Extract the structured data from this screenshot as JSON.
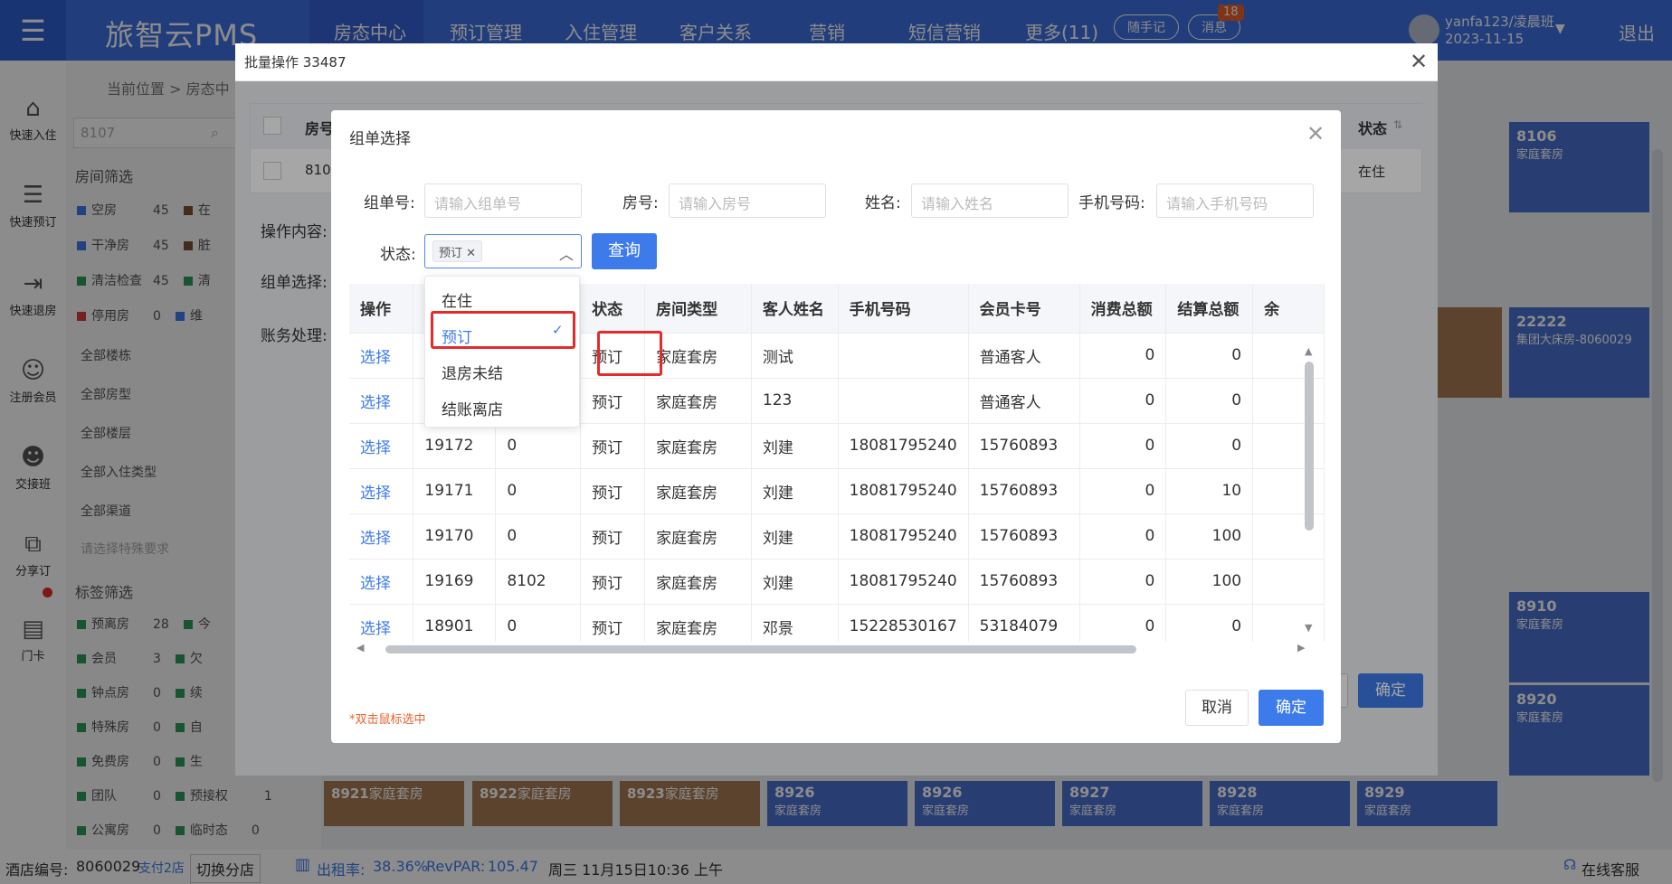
{
  "app": {
    "brand": "旅智云PMS",
    "nav": [
      "房态中心",
      "预订管理",
      "入住管理",
      "客户关系",
      "营销",
      "短信营销",
      "更多(11)"
    ],
    "pill1": "随手记",
    "pill2": "消息",
    "badge": "18",
    "user": "yanfa123/凌晨班",
    "date": "2023-11-15",
    "logout": "退出"
  },
  "sidebar": [
    "快速入住",
    "快速预订",
    "快速退房",
    "注册会员",
    "交接班",
    "分享订",
    "门卡"
  ],
  "breadcrumb": "当前位置 > 房态中",
  "filter": {
    "search": "8107",
    "room_filter": "房间筛选",
    "rows": [
      {
        "a": "空房",
        "n": "45",
        "b": "在"
      },
      {
        "a": "干净房",
        "n": "45",
        "b": "脏"
      },
      {
        "a": "清洁检查",
        "n": "45",
        "b": "清"
      },
      {
        "a": "停用房",
        "n": "0",
        "b": "维"
      }
    ],
    "lines": [
      "全部楼栋",
      "全部房型",
      "全部楼层",
      "全部入住类型",
      "全部渠道"
    ],
    "special": "请选择特殊要求",
    "tag_filter": "标签筛选",
    "tags": [
      {
        "a": "预离房",
        "n": "28",
        "b": "今"
      },
      {
        "a": "会员",
        "n": "3",
        "b": "欠"
      },
      {
        "a": "钟点房",
        "n": "0",
        "b": "续"
      },
      {
        "a": "特殊房",
        "n": "0",
        "b": "自"
      },
      {
        "a": "免费房",
        "n": "0",
        "b": "生"
      },
      {
        "a": "团队",
        "n": "0",
        "b": "预接权",
        "m": "1"
      },
      {
        "a": "公寓房",
        "n": "0",
        "b": "临时态",
        "m": "0"
      }
    ]
  },
  "rooms_bg": {
    "r8106": "8106",
    "r8106t": "家庭套房",
    "r22222": "22222",
    "r22222t": "集团大床房-8060029",
    "r8910": "8910",
    "r8910t": "家庭套房",
    "r8920": "8920",
    "r8920t": "家庭套房",
    "bottom": [
      {
        "n": "8921",
        "t": "家庭套房"
      },
      {
        "n": "8922",
        "t": "家庭套房"
      },
      {
        "n": "8923",
        "t": "家庭套房"
      },
      {
        "n": "8926",
        "t": "家庭套房"
      },
      {
        "n": "8926",
        "t": "家庭套房"
      },
      {
        "n": "8927",
        "t": "家庭套房"
      },
      {
        "n": "8928",
        "t": "家庭套房"
      },
      {
        "n": "8929",
        "t": "家庭套房"
      }
    ]
  },
  "batch": {
    "title": "批量操作 33487",
    "col_room": "房号",
    "room_val": "810",
    "col_status": "状态",
    "status_val": "在住",
    "op_content": "操作内容:",
    "group_sel": "组单选择:",
    "account": "账务处理:",
    "confirm": "确定"
  },
  "group": {
    "title": "组单选择",
    "label_group": "组单号:",
    "ph_group": "请输入组单号",
    "label_room": "房号:",
    "ph_room": "请输入房号",
    "label_name": "姓名:",
    "ph_name": "请输入姓名",
    "label_phone": "手机号码:",
    "ph_phone": "请输入手机号码",
    "label_status": "状态:",
    "status_tag": "预订",
    "query": "查询",
    "note": "*双击鼠标选中",
    "cancel": "取消",
    "ok": "确定"
  },
  "dropdown": [
    "在住",
    "预订",
    "退房未结",
    "结账离店"
  ],
  "table": {
    "headers": [
      "操作",
      "",
      "",
      "状态",
      "房间类型",
      "客人姓名",
      "手机号码",
      "会员卡号",
      "消费总额",
      "结算总额",
      "余"
    ],
    "rows": [
      [
        "选择",
        "",
        "",
        "预订",
        "家庭套房",
        "测试",
        "",
        "普通客人",
        "0",
        "0"
      ],
      [
        "选择",
        "",
        "",
        "预订",
        "家庭套房",
        "123",
        "",
        "普通客人",
        "0",
        "0"
      ],
      [
        "选择",
        "19172",
        "0",
        "预订",
        "家庭套房",
        "刘建",
        "18081795240",
        "15760893",
        "0",
        "0"
      ],
      [
        "选择",
        "19171",
        "0",
        "预订",
        "家庭套房",
        "刘建",
        "18081795240",
        "15760893",
        "0",
        "10"
      ],
      [
        "选择",
        "19170",
        "0",
        "预订",
        "家庭套房",
        "刘建",
        "18081795240",
        "15760893",
        "0",
        "100"
      ],
      [
        "选择",
        "19169",
        "8102",
        "预订",
        "家庭套房",
        "刘建",
        "18081795240",
        "15760893",
        "0",
        "100"
      ],
      [
        "选择",
        "18901",
        "0",
        "预订",
        "家庭套房",
        "邓景",
        "15228530167",
        "53184079",
        "0",
        "0"
      ]
    ]
  },
  "bottom": {
    "store": "酒店编号:",
    "store_id": "8060029",
    "store_link": "支付2店",
    "switch": "切换分店",
    "occupancy": "出租率:",
    "occ_val": "38.36%",
    "revpar": "RevPAR:",
    "revpar_val": "105.47",
    "datetime": "周三 11月15日10:36 上午",
    "service": "在线客服"
  }
}
